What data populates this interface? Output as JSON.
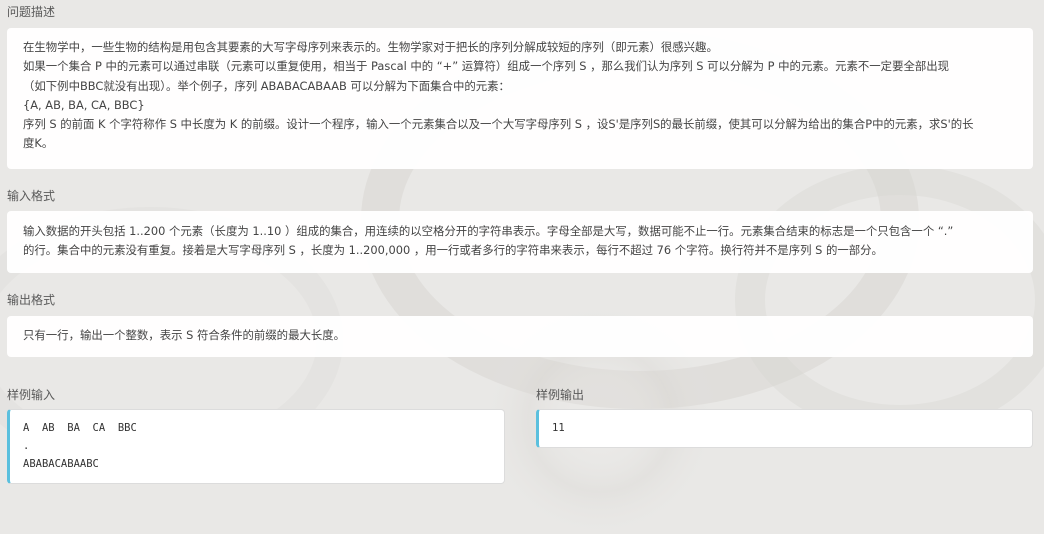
{
  "sections": {
    "description_title": "问题描述",
    "input_format_title": "输入格式",
    "output_format_title": "输出格式",
    "sample_input_title": "样例输入",
    "sample_output_title": "样例输出"
  },
  "description": {
    "lines": [
      "在生物学中，一些生物的结构是用包含其要素的大写字母序列来表示的。生物学家对于把长的序列分解成较短的序列（即元素）很感兴趣。",
      "如果一个集合 P 中的元素可以通过串联（元素可以重复使用，相当于 Pascal 中的 “+” 运算符）组成一个序列 S ，那么我们认为序列 S 可以分解为 P 中的元素。元素不一定要全部出现",
      "（如下例中BBC就没有出现）。举个例子，序列 ABABACABAAB 可以分解为下面集合中的元素：",
      "{A, AB, BA, CA, BBC}",
      "序列 S 的前面 K 个字符称作 S 中长度为 K 的前缀。设计一个程序，输入一个元素集合以及一个大写字母序列 S ，设S'是序列S的最长前缀，使其可以分解为给出的集合P中的元素，求S'的长",
      "度K。"
    ]
  },
  "input_format": {
    "lines": [
      "输入数据的开头包括 1..200 个元素（长度为 1..10 ）组成的集合，用连续的以空格分开的字符串表示。字母全部是大写，数据可能不止一行。元素集合结束的标志是一个只包含一个 “.”",
      "的行。集合中的元素没有重复。接着是大写字母序列 S ，长度为 1..200,000 ，用一行或者多行的字符串来表示，每行不超过 76 个字符。换行符并不是序列 S 的一部分。"
    ]
  },
  "output_format": {
    "lines": [
      "只有一行，输出一个整数，表示 S 符合条件的前缀的最大长度。"
    ]
  },
  "sample_input": {
    "lines": [
      "A  AB  BA  CA  BBC",
      ".",
      "ABABACABAABC"
    ]
  },
  "sample_output": {
    "lines": [
      "11"
    ]
  },
  "colors": {
    "accent": "#5bc0de",
    "background": "#e9e8e6"
  }
}
